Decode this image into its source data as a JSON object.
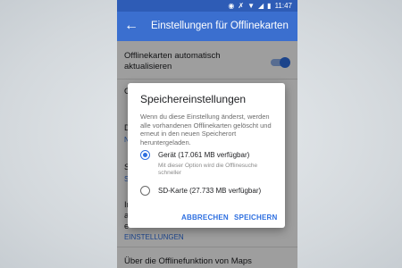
{
  "status_bar": {
    "time": "11:47",
    "icons": [
      "location-icon",
      "vibrate-off-icon",
      "wifi-icon",
      "signal-icon",
      "battery-icon"
    ]
  },
  "app_bar": {
    "title": "Einstellungen für Offlinekarten",
    "back_icon": "arrow-left-icon",
    "color": "#3b6fcf"
  },
  "settings": {
    "auto_update": {
      "label": "Offlinekarten automatisch aktualisieren",
      "enabled": true
    },
    "row2_fragment": "O",
    "row3_fragment": "D",
    "row3_sub_fragment": "N",
    "row4_fragment": "S",
    "row4_link_fragment": "S",
    "row5_fragments": [
      "In",
      "a",
      "e"
    ],
    "settings_link": "EINSTELLUNGEN",
    "about": "Über die Offlinefunktion von Maps"
  },
  "dialog": {
    "title": "Speichereinstellungen",
    "body": "Wenn du diese Einstellung änderst, werden alle vorhandenen Offlinekarten gelöscht und erneut in den neuen Speicherort heruntergeladen.",
    "options": [
      {
        "label": "Gerät (17.061 MB verfügbar)",
        "sub": "Mit dieser Option wird die Offlinesuche schneller",
        "selected": true
      },
      {
        "label": "SD-Karte (27.733 MB verfügbar)",
        "sub": "",
        "selected": false
      }
    ],
    "cancel": "ABBRECHEN",
    "save": "SPEICHERN",
    "accent": "#2e6fe0"
  }
}
